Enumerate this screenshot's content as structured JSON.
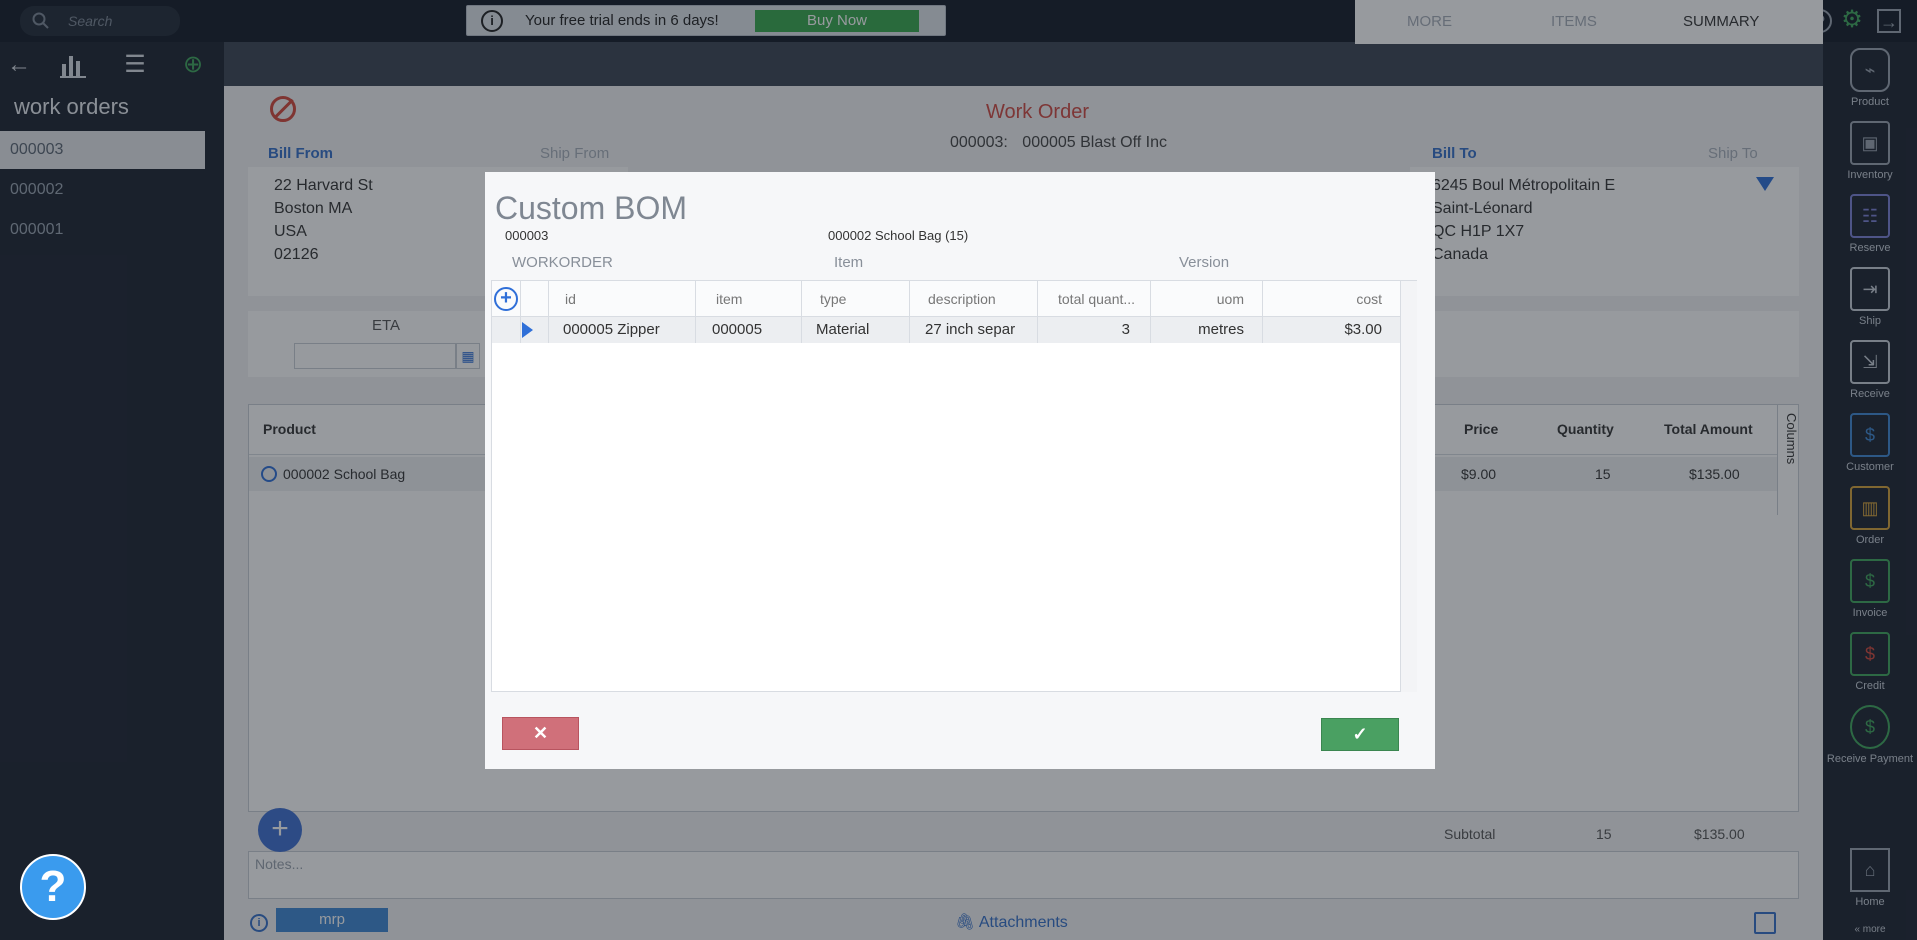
{
  "topbar": {
    "search_placeholder": "Search",
    "trial_text": "Your free trial ends in 6 days!",
    "buy_label": "Buy Now"
  },
  "left": {
    "title": "work orders",
    "items": [
      "000003",
      "000002",
      "000001"
    ]
  },
  "tabs": [
    "MORE",
    "ITEMS",
    "SUMMARY"
  ],
  "work_order": {
    "title": "Work Order",
    "number_label": "000003:",
    "customer": "000005 Blast Off Inc",
    "bill_from": "Bill From",
    "ship_from": "Ship From",
    "bill_to": "Bill To",
    "ship_to": "Ship To",
    "bill_from_address": [
      "22 Harvard St",
      "Boston MA",
      "USA",
      "02126"
    ],
    "bill_to_address": [
      "6245 Boul Métropolitain E",
      "Saint-Léonard",
      "QC H1P 1X7",
      "Canada"
    ],
    "eta_label": "ETA",
    "grid_headers": [
      "Product",
      "Price",
      "Quantity",
      "Total Amount"
    ],
    "grid_row": {
      "product": "000002 School Bag",
      "price": "$9.00",
      "quantity": "15",
      "total": "$135.00"
    },
    "columns_label": "Columns",
    "subtotal_label": "Subtotal",
    "subtotal_qty": "15",
    "subtotal_amount": "$135.00",
    "notes_placeholder": "Notes...",
    "mrp_label": "mrp",
    "attachments_label": "Attachments"
  },
  "modal": {
    "title": "Custom BOM",
    "workorder_value": "000003",
    "item_value": "000002 School Bag (15)",
    "headers": [
      "WORKORDER",
      "Item",
      "Version"
    ],
    "columns": [
      "id",
      "item",
      "type",
      "description",
      "total quant...",
      "uom",
      "cost"
    ],
    "rows": [
      {
        "id": "000005 Zipper",
        "item": "000005",
        "type": "Material",
        "description": "27 inch separ",
        "total_quantity": "3",
        "uom": "metres",
        "cost": "$3.00"
      }
    ],
    "cancel_symbol": "✕",
    "ok_symbol": "✓"
  },
  "rightbar": [
    {
      "label": "Product",
      "icon": "tag-icon"
    },
    {
      "label": "Inventory",
      "icon": "hand-truck-icon"
    },
    {
      "label": "Reserve",
      "icon": "clipboard-icon"
    },
    {
      "label": "Ship",
      "icon": "truck-out-icon"
    },
    {
      "label": "Receive",
      "icon": "truck-in-icon"
    },
    {
      "label": "Customer",
      "icon": "customer-icon"
    },
    {
      "label": "Order",
      "icon": "box-icon"
    },
    {
      "label": "Invoice",
      "icon": "invoice-icon"
    },
    {
      "label": "Credit",
      "icon": "credit-icon"
    },
    {
      "label": "Receive Payment",
      "icon": "piggy-bank-icon"
    },
    {
      "label": "Home",
      "icon": "home-icon"
    }
  ],
  "more_label": "« more",
  "colors": {
    "accent": "#3e87d4",
    "danger": "#d04a42",
    "success": "#4aa062",
    "panel_dark": "#1c2431"
  }
}
